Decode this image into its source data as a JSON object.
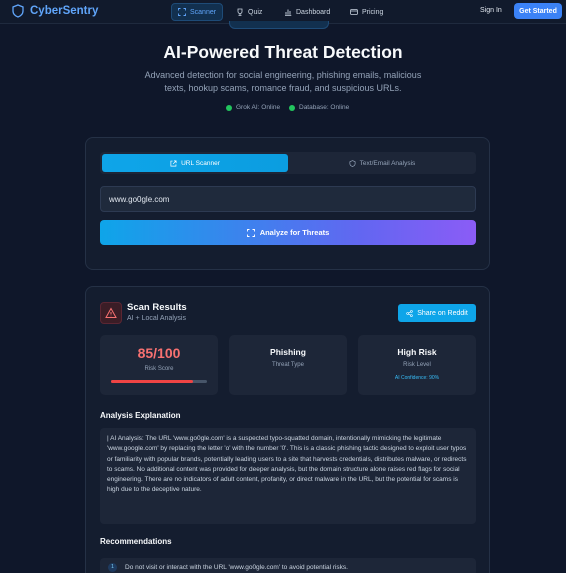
{
  "brand": {
    "name": "CyberSentry"
  },
  "nav": {
    "items": [
      {
        "label": "Scanner",
        "active": true
      },
      {
        "label": "Quiz"
      },
      {
        "label": "Dashboard"
      },
      {
        "label": "Pricing"
      }
    ],
    "sign_in": "Sign In",
    "get_started": "Get Started"
  },
  "hero": {
    "title": "AI-Powered Threat Detection",
    "subtitle": "Advanced detection for social engineering, phishing emails, malicious texts, hookup scams, romance fraud, and suspicious URLs.",
    "status": [
      {
        "label": "Grok AI: Online",
        "color": "#22c55e"
      },
      {
        "label": "Database: Online",
        "color": "#22c55e"
      }
    ]
  },
  "scanner": {
    "tabs": [
      {
        "label": "URL Scanner",
        "active": true
      },
      {
        "label": "Text/Email Analysis"
      }
    ],
    "url_value": "www.go0gle.com",
    "analyze_label": "Analyze for Threats"
  },
  "results": {
    "title": "Scan Results",
    "subtitle": "AI + Local Analysis",
    "share_label": "Share on Reddit",
    "risk_score": {
      "value": "85/100",
      "label": "Risk Score",
      "fraction": 0.85
    },
    "threat_type": {
      "value": "Phishing",
      "label": "Threat Type"
    },
    "risk_level": {
      "value": "High Risk",
      "label": "Risk Level",
      "confidence": "AI Confidence: 90%"
    },
    "explanation_heading": "Analysis Explanation",
    "explanation": "| AI Analysis: The URL 'www.go0gle.com' is a suspected typo-squatted domain, intentionally mimicking the legitimate 'www.google.com' by replacing the letter 'o' with the number '0'. This is a classic phishing tactic designed to exploit user typos or familiarity with popular brands, potentially leading users to a site that harvests credentials, distributes malware, or redirects to scams. No additional content was provided for deeper analysis, but the domain structure alone raises red flags for social engineering. There are no indicators of adult content, profanity, or direct malware in the URL, but the potential for scams is high due to the deceptive nature.",
    "recommendations_heading": "Recommendations",
    "recommendations": [
      {
        "num": "1",
        "text": "Do not visit or interact with the URL 'www.go0gle.com' to avoid potential risks."
      }
    ]
  },
  "colors": {
    "accent": "#3b82f6",
    "danger": "#ef4444",
    "online": "#22c55e"
  }
}
